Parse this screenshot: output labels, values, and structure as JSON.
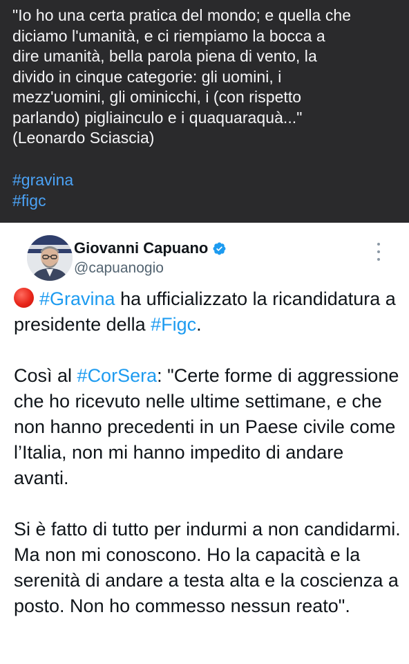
{
  "quote_panel": {
    "text": "\"Io ho una certa pratica del mondo; e quella che\ndiciamo l'umanità, e ci riempiamo la bocca a\ndire umanità, bella parola piena di vento, la\ndivido in cinque categorie: gli uomini, i\nmezz'uomini, gli ominicchi, i (con rispetto\nparlando) pigliainculo e i quaquaraquà...\"\n(Leonardo Sciascia)",
    "hashtags": [
      "#gravina",
      "#figc"
    ],
    "background": "#2a2a2c",
    "hashtag_color": "#4ba2f5"
  },
  "tweet": {
    "author": {
      "display_name": "Giovanni Capuano",
      "handle": "@capuanogio",
      "verified": true,
      "verified_color": "#1d9bf0"
    },
    "more_icon": "more-vertical-icon",
    "hashtag_color": "#1d9bf0",
    "paragraph_1": {
      "emoji": "red-circle-icon",
      "hashtag_1": "#Gravina",
      "text_1": " ha ufficializzato la ricandidatura a presidente della ",
      "hashtag_2": "#Figc",
      "text_2": "."
    },
    "paragraph_2": {
      "text_1": "Così al ",
      "hashtag_1": "#CorSera",
      "text_2": ": \"Certe forme di aggressione che ho ricevuto nelle ultime settimane, e che non hanno precedenti in un Paese civile come l’Italia, non mi hanno impedito di andare avanti."
    },
    "paragraph_3": {
      "text": "Si è fatto di tutto per indurmi a non candidarmi. Ma non mi conoscono. Ho la capacità e la serenità di andare a testa alta e la coscienza a posto. Non ho commesso nessun reato\"."
    }
  }
}
